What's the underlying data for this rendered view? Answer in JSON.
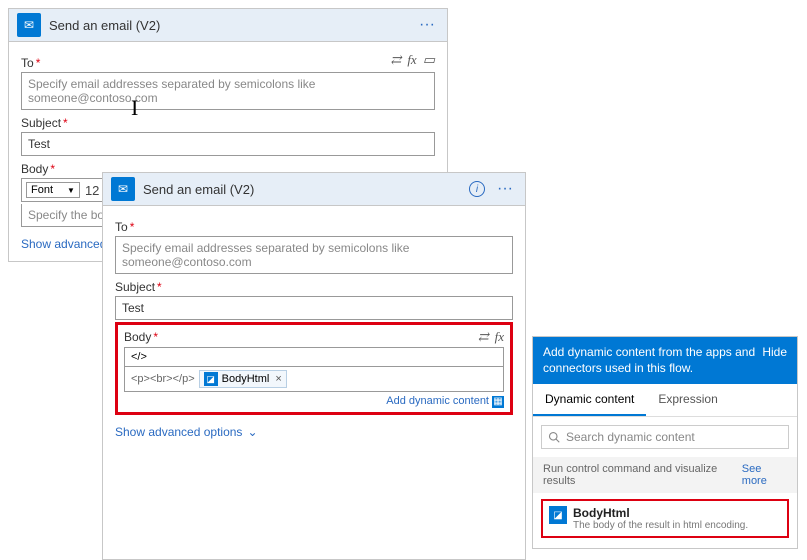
{
  "card1": {
    "title": "Send an email (V2)",
    "to_label": "To",
    "to_placeholder": "Specify email addresses separated by semicolons like someone@contoso.com",
    "subject_label": "Subject",
    "subject_value": "Test",
    "body_label": "Body",
    "font_label": "Font",
    "font_size": "12",
    "body_placeholder": "Specify the body of the",
    "advanced": "Show advanced options"
  },
  "card2": {
    "title": "Send an email (V2)",
    "to_label": "To",
    "to_placeholder": "Specify email addresses separated by semicolons like someone@contoso.com",
    "subject_label": "Subject",
    "subject_value": "Test",
    "body_label": "Body",
    "code_toggle": "</>",
    "body_pre": "<p><br></p>",
    "chip_label": "BodyHtml",
    "add_dynamic": "Add dynamic content",
    "advanced": "Show advanced options"
  },
  "panel": {
    "header": "Add dynamic content from the apps and connectors used in this flow.",
    "hide": "Hide",
    "tab1": "Dynamic content",
    "tab2": "Expression",
    "search_placeholder": "Search dynamic content",
    "section": "Run control command and visualize results",
    "see_more": "See more",
    "item_title": "BodyHtml",
    "item_desc": "The body of the result in html encoding."
  }
}
